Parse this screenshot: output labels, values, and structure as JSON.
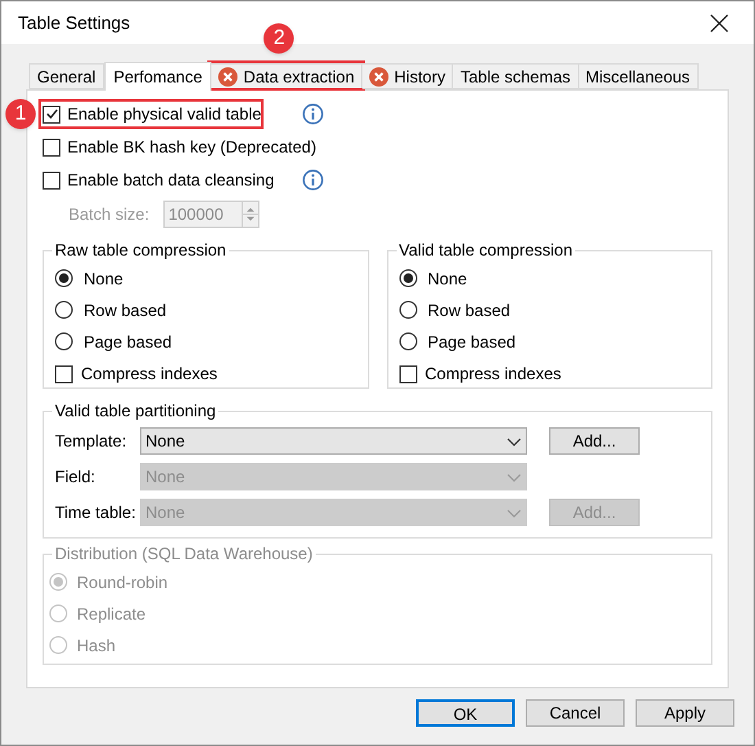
{
  "window": {
    "title": "Table Settings"
  },
  "tabs": [
    {
      "label": "General",
      "selected": false,
      "error": false
    },
    {
      "label": "Perfomance",
      "selected": true,
      "error": false
    },
    {
      "label": "Data extraction",
      "selected": false,
      "error": true,
      "callout": "2"
    },
    {
      "label": "History",
      "selected": false,
      "error": true
    },
    {
      "label": "Table schemas",
      "selected": false,
      "error": false
    },
    {
      "label": "Miscellaneous",
      "selected": false,
      "error": false
    }
  ],
  "options": [
    {
      "label": "Enable physical valid table",
      "checked": true,
      "info": true,
      "callout": "1"
    },
    {
      "label": "Enable BK hash key (Deprecated)",
      "checked": false,
      "info": false
    },
    {
      "label": "Enable batch data cleansing",
      "checked": false,
      "info": true
    }
  ],
  "batch_size": {
    "label": "Batch size:",
    "value": "100000",
    "disabled": true
  },
  "compression_groups": [
    {
      "title": "Raw table compression",
      "options": [
        {
          "label": "None",
          "selected": true
        },
        {
          "label": "Row based",
          "selected": false
        },
        {
          "label": "Page based",
          "selected": false
        }
      ],
      "compress_indexes": {
        "label": "Compress indexes",
        "checked": false
      }
    },
    {
      "title": "Valid table compression",
      "options": [
        {
          "label": "None",
          "selected": true
        },
        {
          "label": "Row based",
          "selected": false
        },
        {
          "label": "Page based",
          "selected": false
        }
      ],
      "compress_indexes": {
        "label": "Compress indexes",
        "checked": false
      }
    }
  ],
  "partitioning": {
    "title": "Valid table partitioning",
    "rows": [
      {
        "label": "Template:",
        "value": "None",
        "disabled": false,
        "button": "Add..."
      },
      {
        "label": "Field:",
        "value": "None",
        "disabled": true
      },
      {
        "label": "Time table:",
        "value": "None",
        "disabled": true,
        "button": "Add..."
      }
    ]
  },
  "distribution": {
    "title": "Distribution (SQL Data Warehouse)",
    "disabled": true,
    "options": [
      {
        "label": "Round-robin",
        "selected": true
      },
      {
        "label": "Replicate",
        "selected": false
      },
      {
        "label": "Hash",
        "selected": false
      }
    ]
  },
  "buttons": [
    {
      "label": "OK",
      "default": true
    },
    {
      "label": "Cancel",
      "default": false
    },
    {
      "label": "Apply",
      "default": false
    }
  ]
}
